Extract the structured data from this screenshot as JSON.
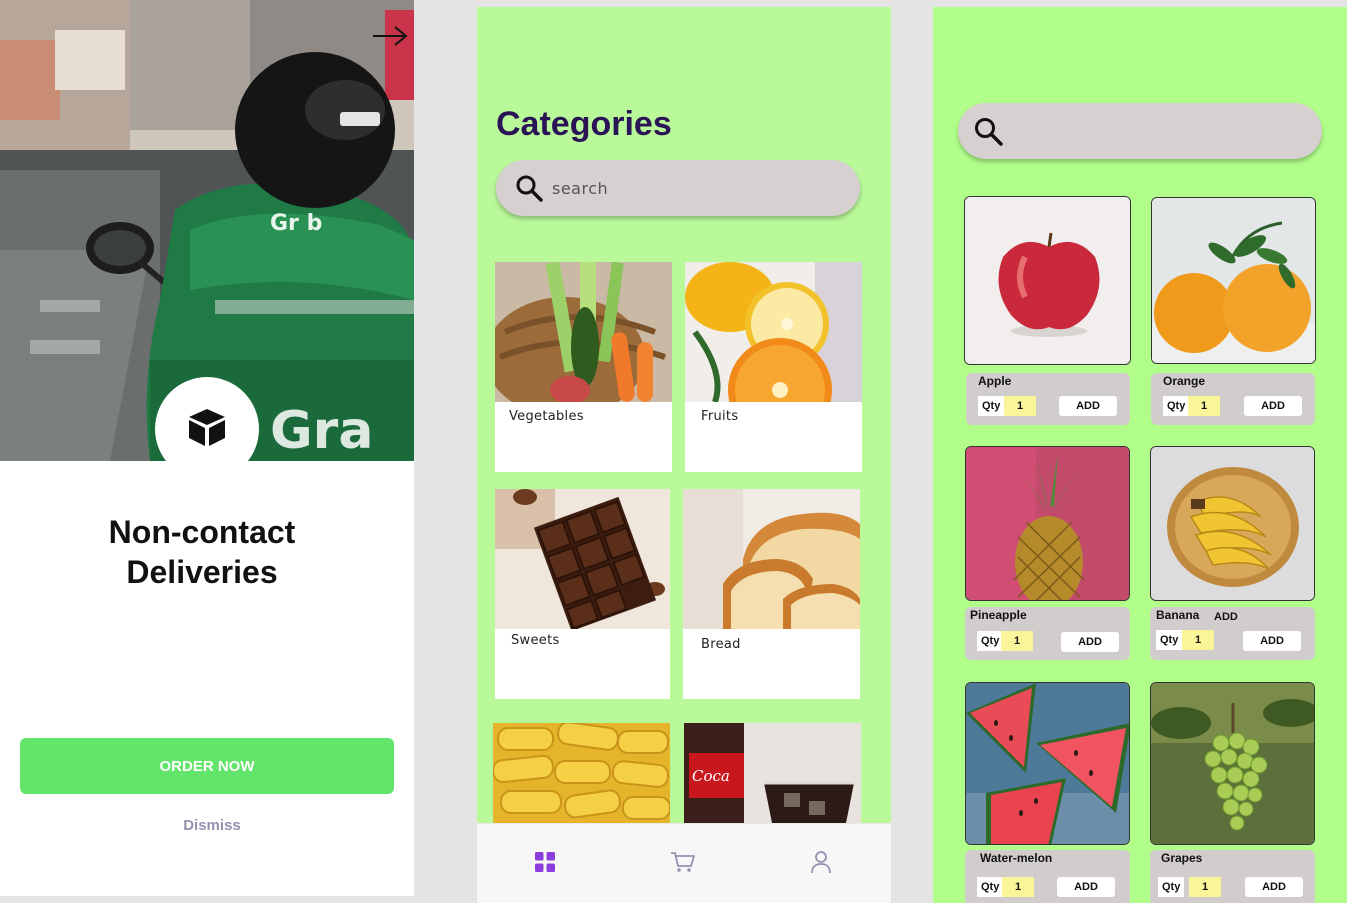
{
  "onboarding": {
    "title_line1": "Non-contact",
    "title_line2": "Deliveries",
    "order_button": "ORDER NOW",
    "dismiss": "Dismiss",
    "accent": "#63e46a",
    "icons": {
      "next": "arrow-right-icon",
      "badge": "package-box-icon"
    }
  },
  "categories": {
    "title": "Categories",
    "search_placeholder": "search",
    "items": [
      {
        "label": "Vegetables"
      },
      {
        "label": "Fruits"
      },
      {
        "label": "Sweets"
      },
      {
        "label": "Bread"
      },
      {
        "label": ""
      },
      {
        "label": ""
      }
    ],
    "nav": [
      {
        "icon": "grid-icon",
        "active": true
      },
      {
        "icon": "cart-icon",
        "active": false
      },
      {
        "icon": "user-icon",
        "active": false
      }
    ],
    "background": "#b9f99a",
    "title_color": "#2b1455",
    "active_nav_color": "#8b3dde"
  },
  "products": {
    "search_value": "",
    "qty_label": "Qty",
    "add_label": "ADD",
    "items": [
      {
        "name": "Apple",
        "qty": "1"
      },
      {
        "name": "Orange",
        "qty": "1"
      },
      {
        "name": "Pineapple",
        "qty": "1"
      },
      {
        "name": "Banana",
        "qty": "1",
        "extra_label": "ADD"
      },
      {
        "name": "Water-melon",
        "qty": "1"
      },
      {
        "name": "Grapes",
        "qty": "1"
      }
    ],
    "background": "#b1ff8a"
  }
}
